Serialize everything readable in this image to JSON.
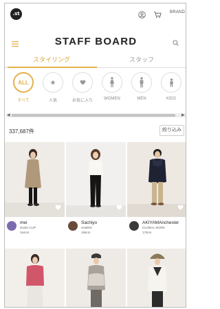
{
  "app": {
    "logo_text": ".st",
    "brand_label": "BRAND",
    "title": "STAFF BOARD"
  },
  "icons": {
    "account": "user-circle-icon",
    "cart": "cart-icon",
    "menu": "hamburger-menu-icon",
    "search": "search-icon",
    "heart": "heart-icon"
  },
  "colors": {
    "accent": "#e3b04b",
    "accent_text": "#d9a233"
  },
  "tabs": [
    {
      "label": "スタイリング",
      "active": true
    },
    {
      "label": "スタッフ",
      "active": false
    }
  ],
  "filters": [
    {
      "label": "すべて",
      "text": "ALL",
      "icon": "all",
      "active": true
    },
    {
      "label": "人気",
      "icon": "star-icon",
      "active": false
    },
    {
      "label": "お気に入り",
      "icon": "heart-icon",
      "active": false
    },
    {
      "label": "WOMEN",
      "icon": "women-icon",
      "active": false
    },
    {
      "label": "MEN",
      "icon": "men-icon",
      "active": false
    },
    {
      "label": "KIDS",
      "icon": "kids-icon",
      "active": false
    }
  ],
  "results": {
    "count": "337,687件",
    "refine_label": "絞り込み"
  },
  "cards": [
    {
      "name": "mei",
      "shop": "studio CLIP",
      "height": "154cm"
    },
    {
      "name": "Sachiyo",
      "shop": "Heather",
      "height": "158cm"
    },
    {
      "name": "AKIYAMAnchester",
      "shop": "GLOBAL WORK",
      "height": "178cm"
    },
    {
      "name": "",
      "shop": "",
      "height": ""
    },
    {
      "name": "",
      "shop": "",
      "height": ""
    },
    {
      "name": "",
      "shop": "",
      "height": ""
    }
  ]
}
